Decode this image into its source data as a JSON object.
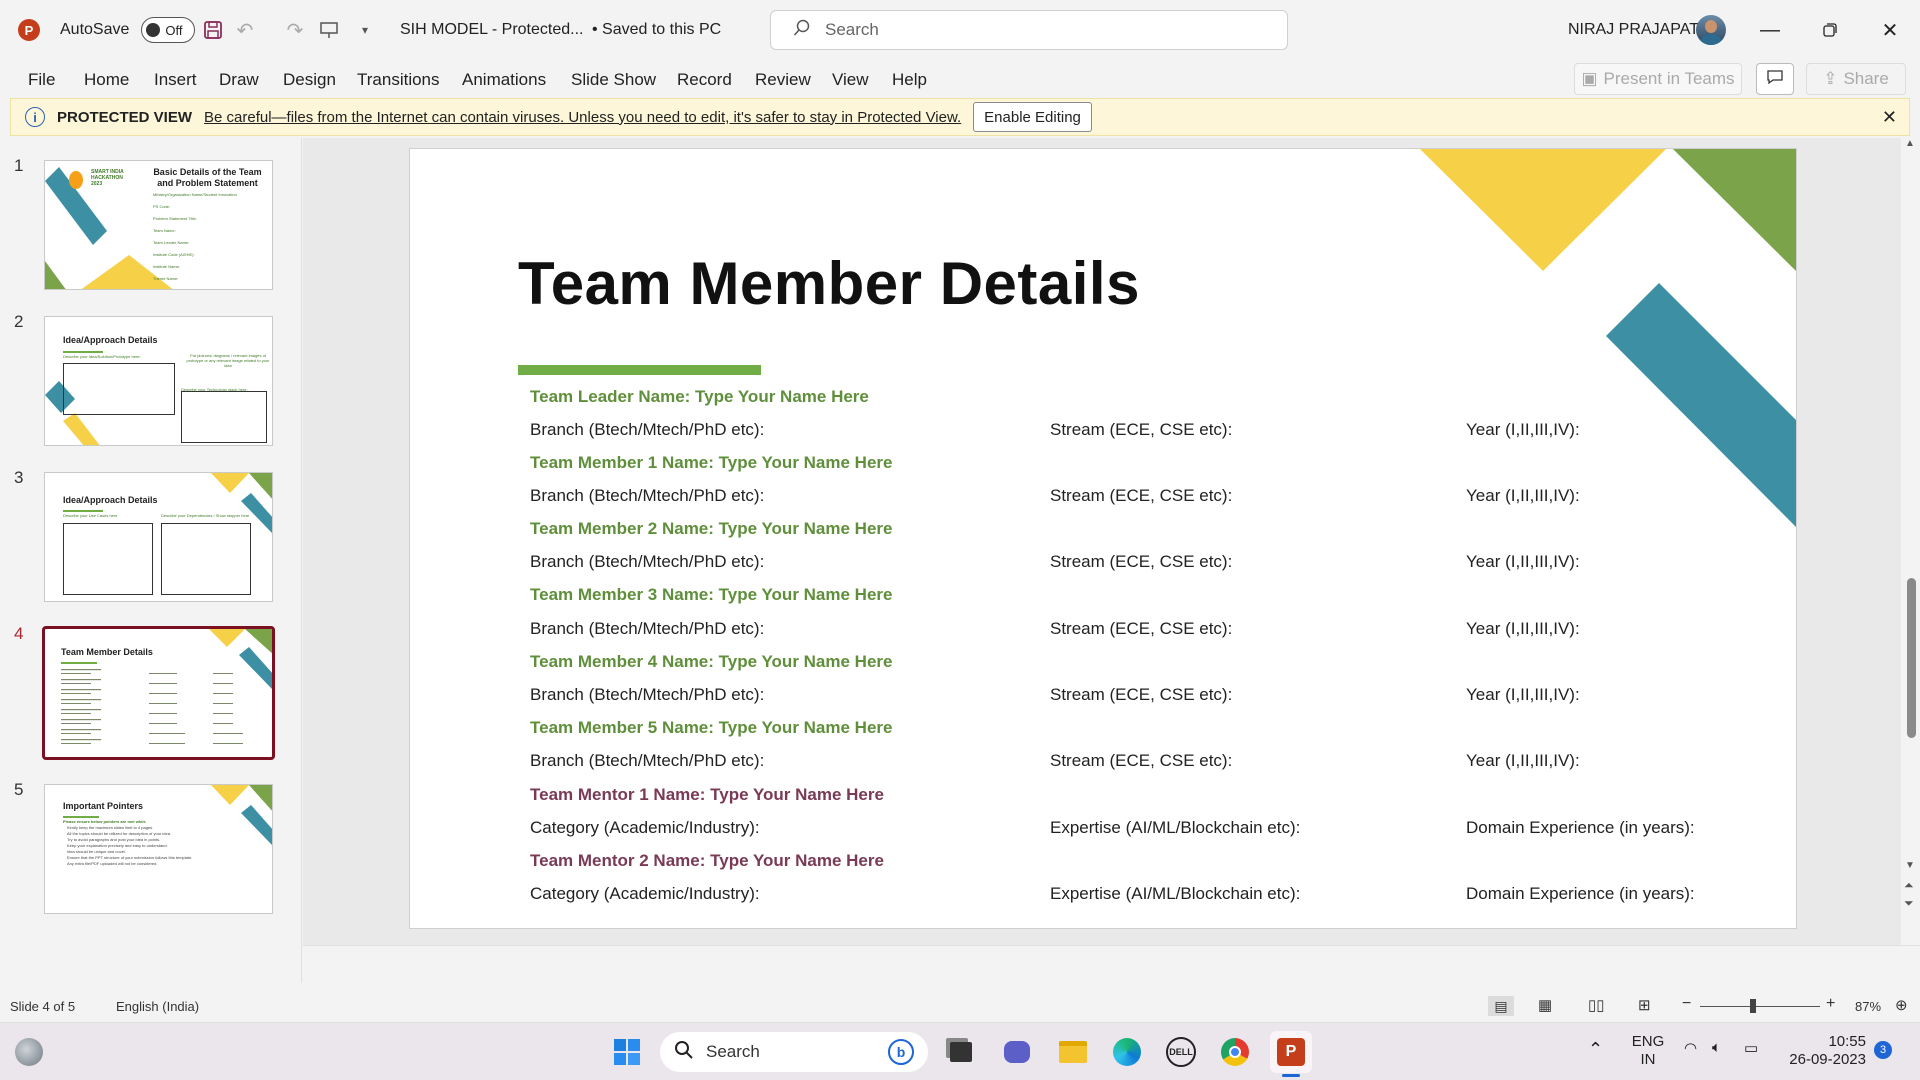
{
  "titlebar": {
    "autosave_label": "AutoSave",
    "autosave_state": "Off",
    "doc_title": "SIH MODEL  -  Protected...",
    "save_state": "• Saved to this PC",
    "search_placeholder": "Search",
    "user_name": "NIRAJ PRAJAPATI"
  },
  "menu": {
    "items": [
      "File",
      "Home",
      "Insert",
      "Draw",
      "Design",
      "Transitions",
      "Animations",
      "Slide Show",
      "Record",
      "Review",
      "View",
      "Help"
    ],
    "present_teams": "Present in Teams",
    "share": "Share"
  },
  "protected_view": {
    "title": "PROTECTED VIEW",
    "message": "Be careful—files from the Internet can contain viruses. Unless you need to edit, it's safer to stay in Protected View.",
    "button": "Enable Editing"
  },
  "thumbnails": [
    {
      "num": "1",
      "title": "Basic Details of the Team and Problem Statement",
      "logo": "SMART INDIA HACKATHON 2023",
      "lines": [
        "Ministry/Organization Name/Student Innovation",
        "PS Code:",
        "Problem Statement Title:",
        "Team Name:",
        "Team Leader Name:",
        "Institute Code (AISHE):",
        "Institute Name:",
        "Theme Name:"
      ]
    },
    {
      "num": "2",
      "title": "Idea/Approach Details",
      "lines": [
        "Describe your Idea/Solution/Prototype here:",
        "Describe your Technology stack here:",
        "Put pictures/ diagrams / relevant images of prototype or any relevant image related to your idea"
      ]
    },
    {
      "num": "3",
      "title": "Idea/Approach Details",
      "lines": [
        "Describe your Use Cases here",
        "Describe your Dependencies / Show stopper here"
      ]
    },
    {
      "num": "4",
      "title": "Team Member Details",
      "lines": []
    },
    {
      "num": "5",
      "title": "Important Pointers",
      "lines": [
        "Please ensure below pointers are met while",
        "Kindly keep the maximum slides limit to 4 pages.",
        "All the topics should be utilized for description of your idea.",
        "Try to avoid paragraphs and post your idea in points.",
        "Keep your explanation precisely and easy to understand.",
        "Idea should be unique and novel.",
        "Ensure that the PPT structure of your submission follows this template.",
        "Any extra file/PDF uploaded will not be considered."
      ]
    }
  ],
  "slide": {
    "title": "Team Member Details",
    "members": [
      {
        "name": "Team Leader Name: Type Your Name Here",
        "kind": "member",
        "f1": "Branch (Btech/Mtech/PhD etc):",
        "f2": "Stream (ECE, CSE etc):",
        "f3": "Year (I,II,III,IV):"
      },
      {
        "name": "Team Member 1 Name: Type Your Name Here",
        "kind": "member",
        "f1": "Branch (Btech/Mtech/PhD etc):",
        "f2": "Stream (ECE, CSE etc):",
        "f3": "Year (I,II,III,IV):"
      },
      {
        "name": "Team Member 2 Name: Type Your Name Here",
        "kind": "member",
        "f1": "Branch (Btech/Mtech/PhD etc):",
        "f2": "Stream (ECE, CSE etc):",
        "f3": "Year (I,II,III,IV):"
      },
      {
        "name": "Team Member 3 Name: Type Your Name Here",
        "kind": "member",
        "f1": "Branch (Btech/Mtech/PhD etc):",
        "f2": "Stream (ECE, CSE etc):",
        "f3": "Year (I,II,III,IV):"
      },
      {
        "name": "Team Member 4 Name: Type Your Name Here",
        "kind": "member",
        "f1": "Branch (Btech/Mtech/PhD etc):",
        "f2": "Stream (ECE, CSE etc):",
        "f3": "Year (I,II,III,IV):"
      },
      {
        "name": "Team Member 5 Name: Type Your Name Here",
        "kind": "member",
        "f1": "Branch (Btech/Mtech/PhD etc):",
        "f2": "Stream (ECE, CSE etc):",
        "f3": "Year (I,II,III,IV):"
      },
      {
        "name": "Team Mentor 1 Name: Type Your Name Here",
        "kind": "mentor",
        "f1": "Category (Academic/Industry):",
        "f2": "Expertise (AI/ML/Blockchain etc):",
        "f3": "Domain Experience (in years):"
      },
      {
        "name": "Team Mentor 2 Name: Type Your Name Here",
        "kind": "mentor",
        "f1": "Category (Academic/Industry):",
        "f2": "Expertise (AI/ML/Blockchain etc):",
        "f3": "Domain Experience (in years):"
      }
    ]
  },
  "status": {
    "slide_counter": "Slide 4 of 5",
    "language": "English (India)",
    "zoom": "87%"
  },
  "taskbar": {
    "search": "Search",
    "lang_line1": "ENG",
    "lang_line2": "IN",
    "time": "10:55",
    "date": "26-09-2023",
    "notif_count": "3"
  },
  "colors": {
    "accent_green": "#70ad47",
    "teal": "#3d8fa3",
    "yellow": "#f6d046",
    "olive": "#7aa34a",
    "mentor_purple": "#7a3a55",
    "selected_border": "#7b1020"
  }
}
